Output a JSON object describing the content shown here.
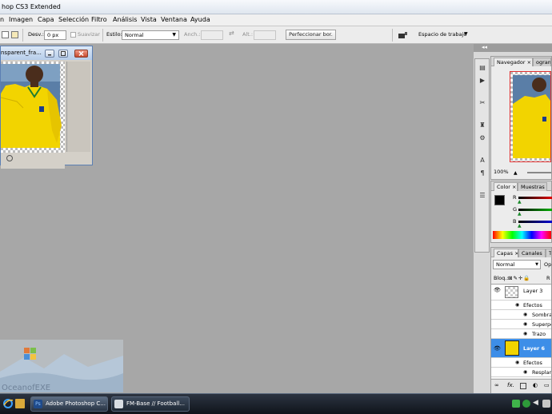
{
  "window": {
    "title": "hop CS3 Extended"
  },
  "menu": [
    "n",
    "Imagen",
    "Capa",
    "Selección",
    "Filtro",
    "Análisis",
    "Vista",
    "Ventana",
    "Ayuda"
  ],
  "options": {
    "feather_label": "Desv.:",
    "feather_value": "0 px",
    "antialias_label": "Suavizar",
    "style_label": "Estilo:",
    "style_value": "Normal",
    "width_label": "Anch.:",
    "height_label": "Alt.:",
    "refine_button": "Perfeccionar bor.",
    "workspace_label": "Espacio de trabajo"
  },
  "document": {
    "title": "nsparent_fra..."
  },
  "navigator": {
    "tabs": [
      "Navegador",
      "ograma"
    ],
    "zoom": "100%"
  },
  "color_panel": {
    "tabs": [
      "Color",
      "Muestras"
    ],
    "channels": [
      "R",
      "G",
      "B"
    ]
  },
  "layers_panel": {
    "tabs": [
      "Capas",
      "Canales",
      "T"
    ],
    "blend_mode": "Normal",
    "opacity_label": "Op",
    "lock_label": "Bloq.:",
    "fill_label": "R",
    "rows": [
      {
        "label": "Layer 3",
        "type": "layer"
      },
      {
        "label": "Efectos",
        "type": "effects"
      },
      {
        "label": "Sombra",
        "type": "effect"
      },
      {
        "label": "Superpo",
        "type": "effect"
      },
      {
        "label": "Trazo",
        "type": "effect"
      },
      {
        "label": "Layer 6",
        "type": "layer-selected"
      },
      {
        "label": "Efectos",
        "type": "effects"
      },
      {
        "label": "Resplanc",
        "type": "effect"
      }
    ]
  },
  "watermark": {
    "text": "OceanofEXE"
  },
  "taskbar": {
    "items": [
      {
        "label": "Adobe Photoshop C..."
      },
      {
        "label": "FM-Base // Football..."
      }
    ]
  },
  "colors": {
    "workspace": "#a7a7a7",
    "selection": "#3d8ee8",
    "jersey": "#f2d400",
    "taskbar": "#1b222c"
  }
}
